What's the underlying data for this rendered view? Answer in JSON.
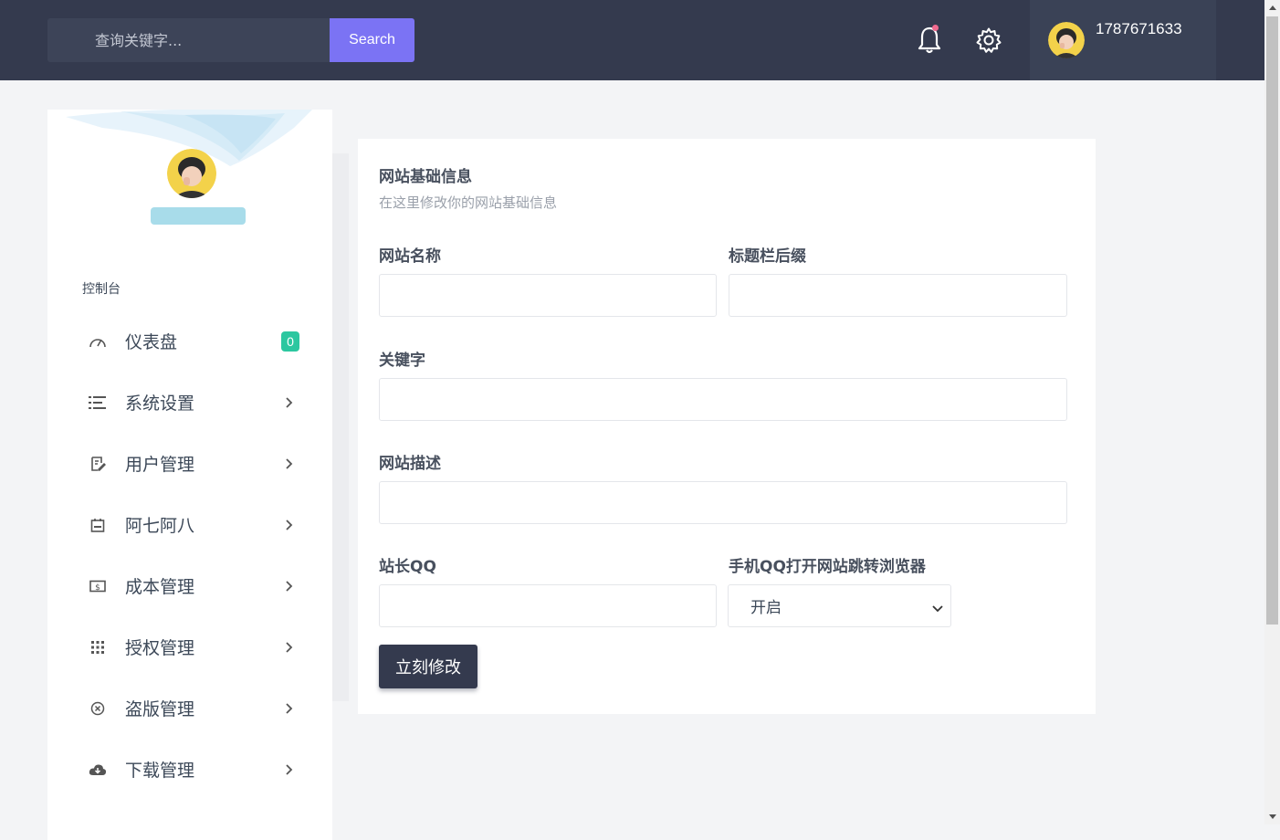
{
  "topbar": {
    "search_placeholder": "查询关键字...",
    "search_button": "Search",
    "user_id": "1787671633"
  },
  "sidebar": {
    "section_title": "控制台",
    "items": [
      {
        "label": "仪表盘",
        "icon": "gauge-icon",
        "badge": "0"
      },
      {
        "label": "系统设置",
        "icon": "list-icon"
      },
      {
        "label": "用户管理",
        "icon": "edit-note-icon"
      },
      {
        "label": "阿七阿八",
        "icon": "calendar-icon"
      },
      {
        "label": "成本管理",
        "icon": "money-icon"
      },
      {
        "label": "授权管理",
        "icon": "grid-icon"
      },
      {
        "label": "盗版管理",
        "icon": "close-circle-icon"
      },
      {
        "label": "下载管理",
        "icon": "cloud-download-icon"
      }
    ]
  },
  "form": {
    "title": "网站基础信息",
    "subtitle": "在这里修改你的网站基础信息",
    "site_name_label": "网站名称",
    "title_suffix_label": "标题栏后缀",
    "keywords_label": "关键字",
    "description_label": "网站描述",
    "owner_qq_label": "站长QQ",
    "mobile_qq_label": "手机QQ打开网站跳转浏览器",
    "mobile_qq_value": "开启",
    "submit_label": "立刻修改"
  },
  "colors": {
    "topbar_bg": "#343a4e",
    "search_button_bg": "#7b73f4",
    "badge_bg": "#2cc7a0",
    "submit_bg": "#343a4e"
  }
}
